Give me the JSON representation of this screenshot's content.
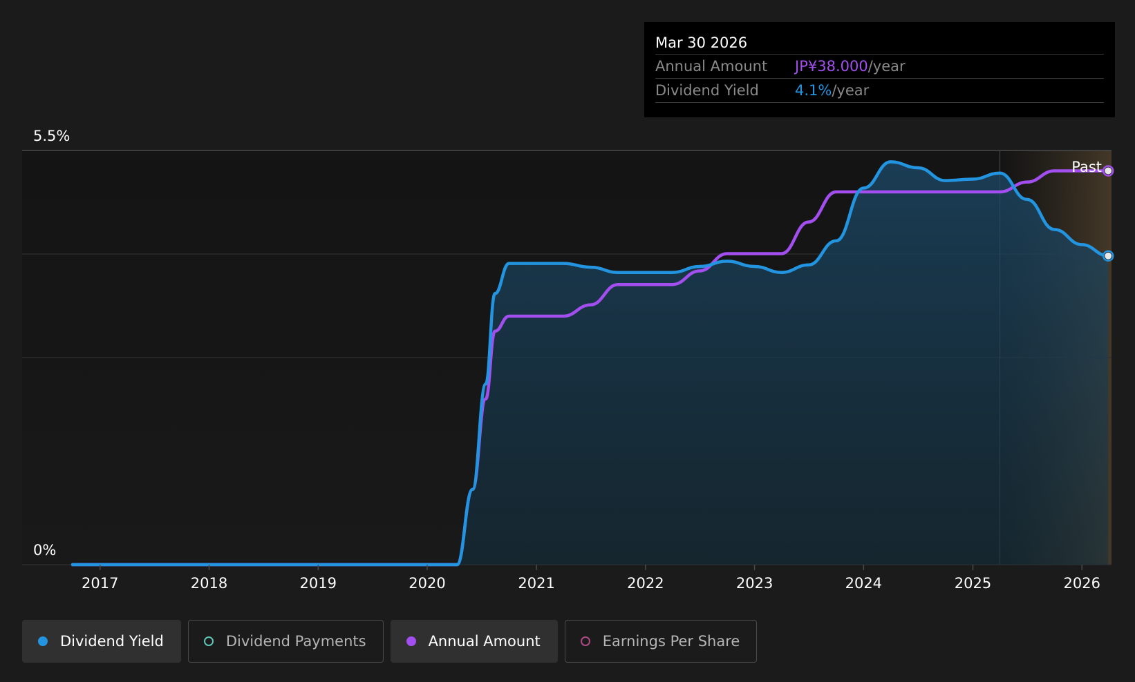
{
  "colors": {
    "yield": "#2394e0",
    "annual": "#a34ff0",
    "payments": "#5fc7b8",
    "eps": "#b04a85"
  },
  "tooltip": {
    "date": "Mar 30 2026",
    "rows": [
      {
        "label": "Annual Amount",
        "value": "JP¥38.000",
        "unit": "/year"
      },
      {
        "label": "Dividend Yield",
        "value": "4.1%",
        "unit": "/year"
      }
    ]
  },
  "chart_data": {
    "type": "line",
    "y_tick_labels": [
      "5.5%",
      "0%"
    ],
    "ylim": [
      0,
      5.5
    ],
    "xlim": [
      "2016-04-15",
      "2026-04-10"
    ],
    "x_ticks": [
      "2017",
      "2018",
      "2019",
      "2020",
      "2021",
      "2022",
      "2023",
      "2024",
      "2025",
      "2026"
    ],
    "past_label": "Past",
    "past_region_start": "2025-04-01",
    "grid": "horizontal",
    "series": [
      {
        "name": "Dividend Yield",
        "filled": true,
        "x": [
          "2016-10-01",
          "2017-06-01",
          "2018-06-01",
          "2019-06-01",
          "2020-01-01",
          "2020-04-10",
          "2020-06-01",
          "2020-07-15",
          "2020-08-15",
          "2020-10-01",
          "2021-04-01",
          "2021-07-01",
          "2021-10-01",
          "2022-04-01",
          "2022-07-01",
          "2022-10-01",
          "2023-01-01",
          "2023-04-01",
          "2023-07-01",
          "2023-10-01",
          "2024-01-01",
          "2024-04-01",
          "2024-07-01",
          "2024-10-01",
          "2025-01-01",
          "2025-04-01",
          "2025-07-01",
          "2025-10-01",
          "2026-01-01",
          "2026-03-30"
        ],
        "values": [
          0,
          0,
          0,
          0,
          0,
          0,
          1.0,
          2.4,
          3.6,
          4.0,
          4.0,
          3.95,
          3.88,
          3.88,
          3.96,
          4.03,
          3.96,
          3.88,
          3.98,
          4.3,
          5.0,
          5.35,
          5.27,
          5.1,
          5.12,
          5.2,
          4.85,
          4.45,
          4.25,
          4.1
        ]
      },
      {
        "name": "Annual Amount",
        "filled": false,
        "x": [
          "2016-10-01",
          "2017-06-01",
          "2018-06-01",
          "2019-06-01",
          "2020-01-01",
          "2020-04-10",
          "2020-06-01",
          "2020-07-15",
          "2020-08-15",
          "2020-10-01",
          "2021-04-01",
          "2021-07-01",
          "2021-10-01",
          "2022-04-01",
          "2022-07-01",
          "2022-10-01",
          "2023-04-01",
          "2023-07-01",
          "2023-10-01",
          "2024-10-01",
          "2025-04-01",
          "2025-07-01",
          "2025-10-01",
          "2026-03-30"
        ],
        "values": [
          0,
          0,
          0,
          0,
          0,
          0,
          1.0,
          2.2,
          3.1,
          3.3,
          3.3,
          3.45,
          3.72,
          3.72,
          3.9,
          4.13,
          4.13,
          4.55,
          4.95,
          4.95,
          4.95,
          5.08,
          5.23,
          5.23
        ]
      }
    ]
  },
  "legend": [
    {
      "label": "Dividend Yield",
      "active": true,
      "filled": true,
      "color_key": "yield"
    },
    {
      "label": "Dividend Payments",
      "active": false,
      "filled": false,
      "color_key": "payments"
    },
    {
      "label": "Annual Amount",
      "active": true,
      "filled": true,
      "color_key": "annual"
    },
    {
      "label": "Earnings Per Share",
      "active": false,
      "filled": false,
      "color_key": "eps"
    }
  ]
}
